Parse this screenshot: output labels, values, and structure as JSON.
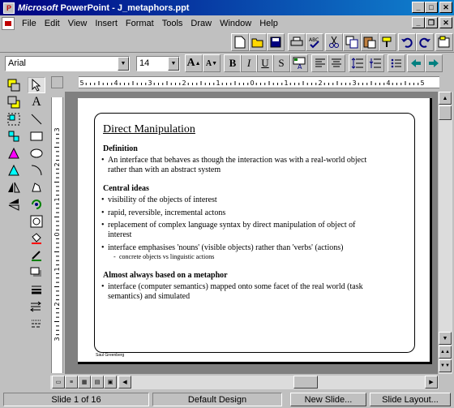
{
  "window": {
    "app_name": "Microsoft",
    "title": " PowerPoint - J_metaphors.ppt"
  },
  "menu": [
    "File",
    "Edit",
    "View",
    "Insert",
    "Format",
    "Tools",
    "Draw",
    "Window",
    "Help"
  ],
  "format": {
    "font": "Arial",
    "size": "14"
  },
  "slide": {
    "title": "Direct Manipulation",
    "sections": [
      {
        "heading": "Definition",
        "bullets": [
          "An interface that behaves as though the interaction was with a real-world object",
          "rather than with an abstract system"
        ]
      },
      {
        "heading": "Central ideas",
        "bullets": [
          "visibility of the objects of interest",
          "rapid, reversible, incremental actons",
          "replacement of complex language syntax by direct manipulation of object of",
          "interest",
          "interface emphasises 'nouns' (visible objects) rather than 'verbs' (actions)"
        ],
        "sub": "concrete objects vs linguistic actions"
      },
      {
        "heading": "Almost always based on a metaphor",
        "bullets": [
          "interface (computer semantics) mapped onto some facet of the real world (task",
          "semantics) and simulated"
        ]
      }
    ],
    "author": "Saul Greenberg"
  },
  "status": {
    "slide_pos": "Slide 1 of 16",
    "design": "Default Design",
    "new_slide": "New Slide...",
    "slide_layout": "Slide Layout..."
  },
  "ruler": {
    "h_labels": [
      "5",
      "4",
      "3",
      "2",
      "1",
      "0",
      "1",
      "2",
      "3",
      "4",
      "5"
    ],
    "v_labels": [
      "3",
      "2",
      "1",
      "0",
      "1",
      "2",
      "3"
    ]
  }
}
